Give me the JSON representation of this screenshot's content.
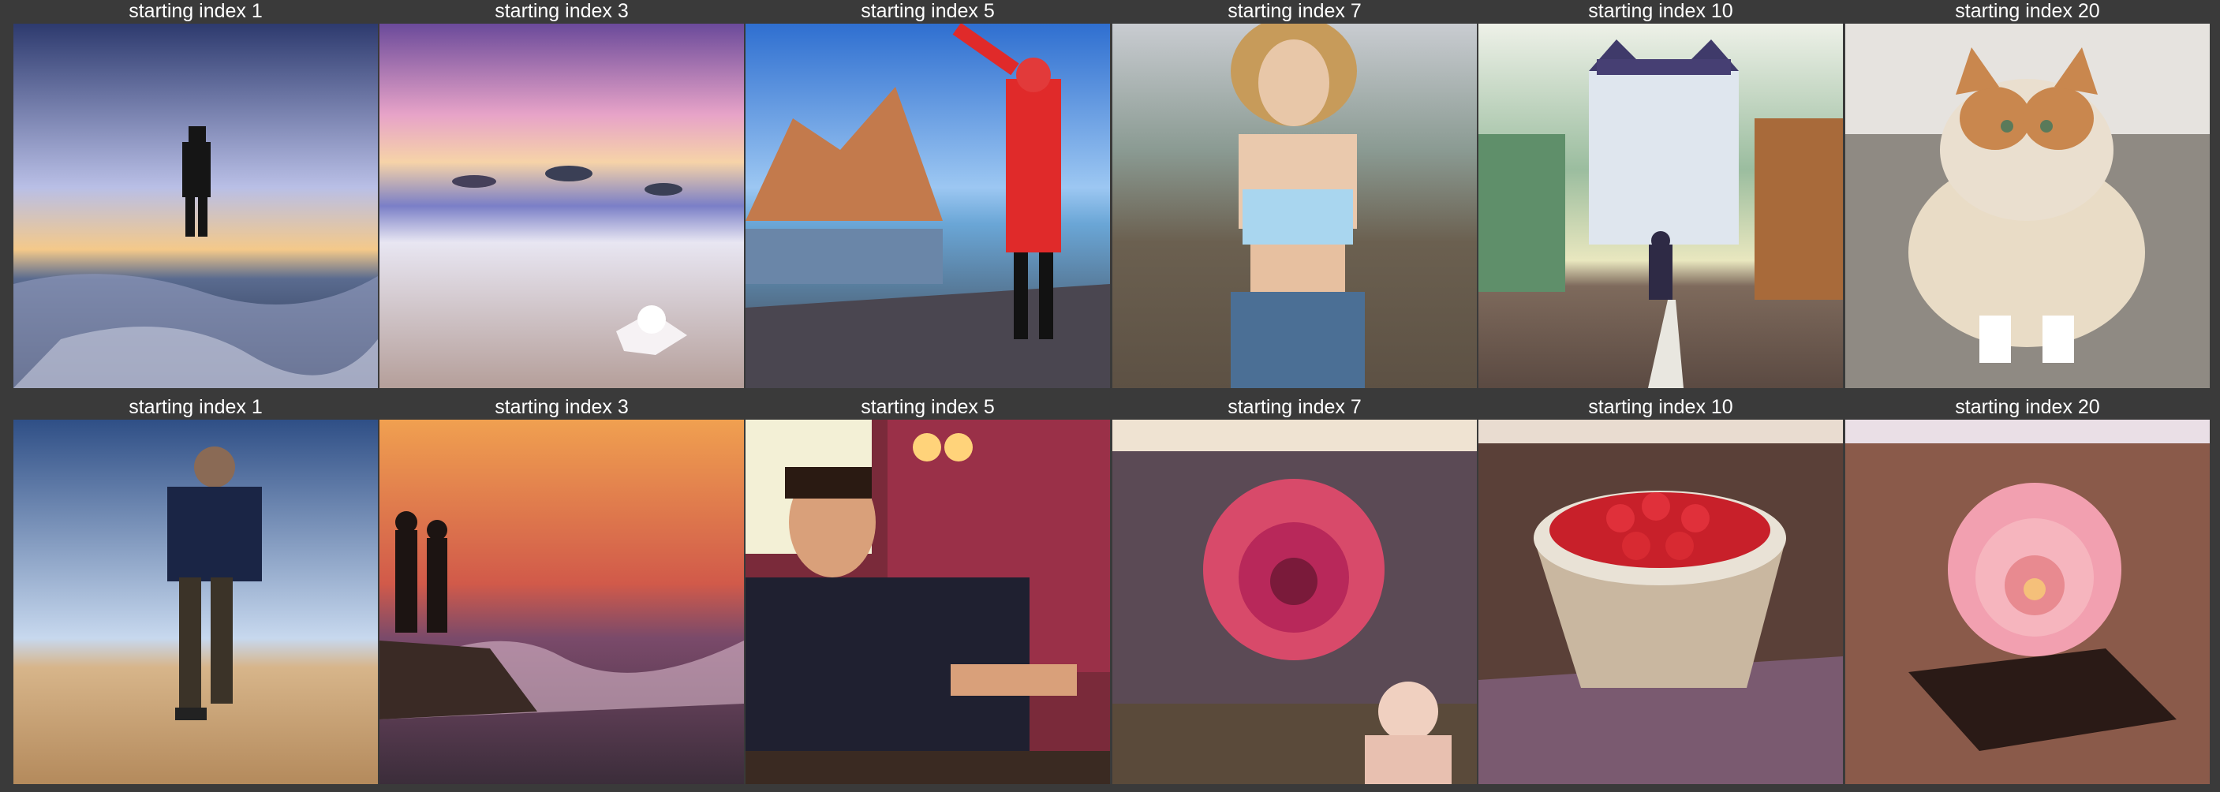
{
  "rows": [
    {
      "cells": [
        {
          "label": "starting index 1",
          "image": "silhouette-on-beach-at-dusk"
        },
        {
          "label": "starting index 3",
          "image": "white-flower-on-shore-pink-sunset"
        },
        {
          "label": "starting index 5",
          "image": "woman-in-red-coat-by-lake-and-mountains"
        },
        {
          "label": "starting index 7",
          "image": "woman-walking-on-road"
        },
        {
          "label": "starting index 10",
          "image": "person-walking-to-chateau"
        },
        {
          "label": "starting index 20",
          "image": "fluffy-cat-on-gravel"
        }
      ]
    },
    {
      "cells": [
        {
          "label": "starting index 1",
          "image": "man-running-on-sand"
        },
        {
          "label": "starting index 3",
          "image": "couple-silhouette-orange-sunset-sea"
        },
        {
          "label": "starting index 5",
          "image": "man-in-suit-indoors"
        },
        {
          "label": "starting index 7",
          "image": "pink-rose-and-child"
        },
        {
          "label": "starting index 10",
          "image": "bowl-of-strawberries"
        },
        {
          "label": "starting index 20",
          "image": "pink-flower-on-table"
        }
      ]
    }
  ]
}
